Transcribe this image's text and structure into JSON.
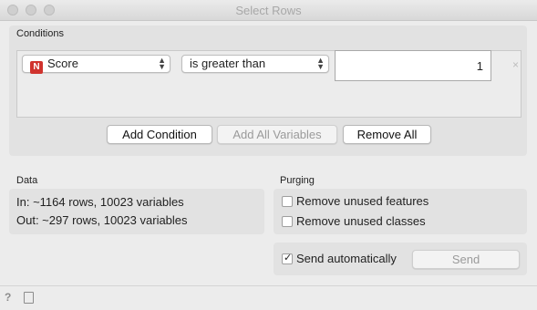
{
  "window": {
    "title": "Select Rows"
  },
  "conditions": {
    "section_label": "Conditions",
    "row": {
      "variable_badge": "N",
      "variable": "Score",
      "operator": "is greater than",
      "value": "1",
      "remove_glyph": "×"
    },
    "buttons": {
      "add_condition": "Add Condition",
      "add_all_variables": "Add All Variables",
      "remove_all": "Remove All"
    }
  },
  "data": {
    "section_label": "Data",
    "in_line": "In: ~1164 rows, 10023 variables",
    "out_line": "Out: ~297 rows, 10023 variables"
  },
  "purging": {
    "section_label": "Purging",
    "remove_unused_features": {
      "label": "Remove unused features",
      "checked": false
    },
    "remove_unused_classes": {
      "label": "Remove unused classes",
      "checked": false
    }
  },
  "send": {
    "send_automatically": {
      "label": "Send automatically",
      "checked": true
    },
    "send_button": "Send"
  },
  "status_bar": {
    "icons": [
      "help-icon",
      "report-icon"
    ]
  },
  "colors": {
    "badge_numeric": "#d0332e",
    "window_bg": "#ececec",
    "group_bg": "#e2e2e2"
  }
}
